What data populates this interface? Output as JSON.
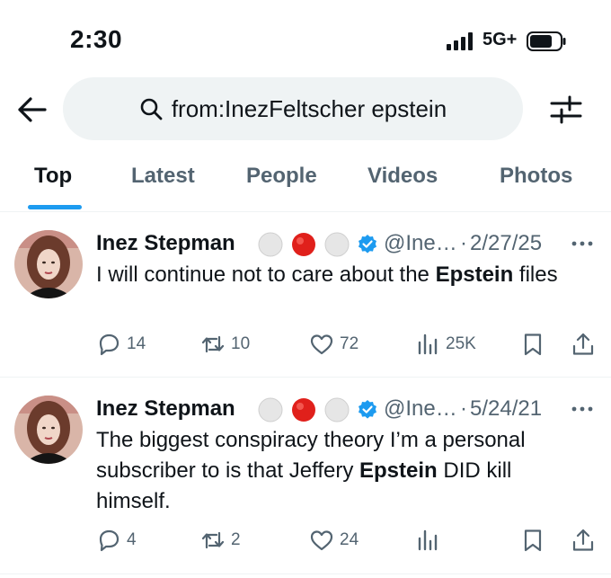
{
  "status_bar": {
    "time": "2:30",
    "network": "5G+"
  },
  "search": {
    "query": "from:InezFeltscher epstein"
  },
  "tabs": [
    {
      "label": "Top",
      "active": true
    },
    {
      "label": "Latest",
      "active": false
    },
    {
      "label": "People",
      "active": false
    },
    {
      "label": "Videos",
      "active": false
    },
    {
      "label": "Photos",
      "active": false
    }
  ],
  "tweets": [
    {
      "display_name": "Inez Stepman",
      "handle": "@Ine…",
      "separator": "·",
      "date": "2/27/25",
      "text_parts": [
        "I will continue not to care about the ",
        "Epstein",
        " files"
      ],
      "replies": "14",
      "reposts": "10",
      "likes": "72",
      "views": "25K"
    },
    {
      "display_name": "Inez Stepman",
      "handle": "@Ine…",
      "separator": "·",
      "date": "5/24/21",
      "text_parts": [
        "The biggest conspiracy theory I’m a personal subscriber to is that Jeffery ",
        "Epstein",
        " DID kill himself."
      ],
      "replies": "4",
      "reposts": "2",
      "likes": "24",
      "views": ""
    }
  ],
  "colors": {
    "accent": "#1d9bf0",
    "text_primary": "#0f1419",
    "text_secondary": "#536471",
    "search_bg": "#eff3f4",
    "badge_red": "#e0201b"
  },
  "icons": [
    "back-arrow-icon",
    "search-icon",
    "filter-sliders-icon",
    "verified-badge-icon",
    "more-icon",
    "reply-icon",
    "repost-icon",
    "like-icon",
    "views-icon",
    "bookmark-icon",
    "share-icon"
  ]
}
